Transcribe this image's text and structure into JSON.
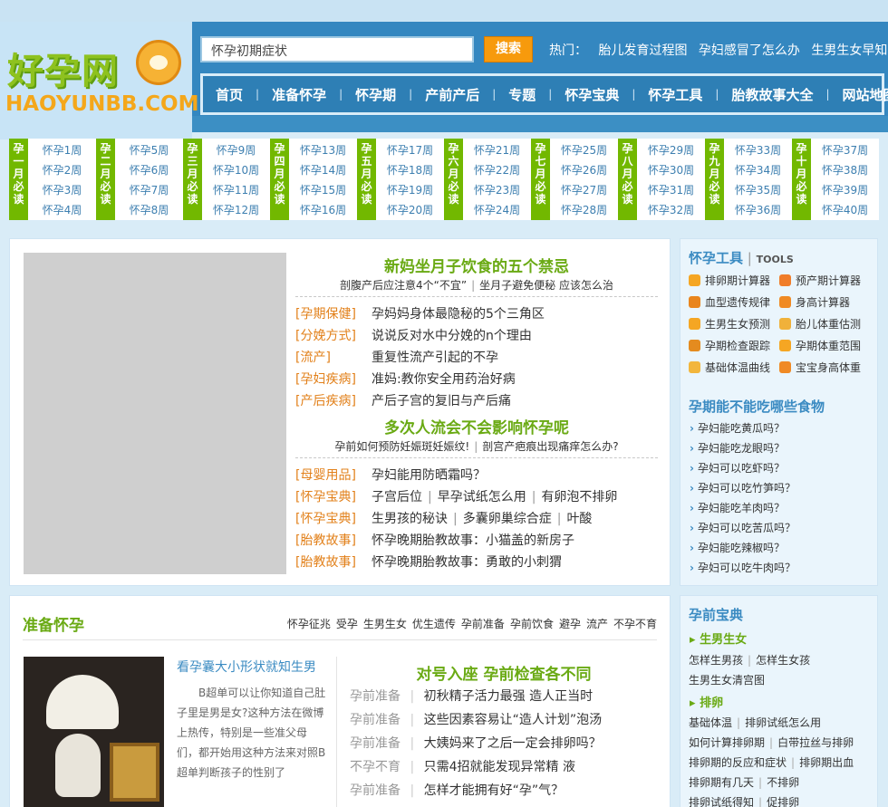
{
  "header": {
    "logo_text": "好孕网",
    "logo_sub": "HAOYUNBB.COM",
    "search_value": "怀孕初期症状",
    "search_button": "搜索",
    "hot_label": "热门：",
    "hot_links": [
      "胎儿发育过程图",
      "孕妇感冒了怎么办",
      "生男生女早知道"
    ]
  },
  "nav": [
    "首页",
    "准备怀孕",
    "怀孕期",
    "产前产后",
    "专题",
    "怀孕宝典",
    "怀孕工具",
    "胎教故事大全",
    "网站地图"
  ],
  "week_grid": [
    {
      "month": "孕一月必读",
      "weeks": [
        "怀孕1周",
        "怀孕2周",
        "怀孕3周",
        "怀孕4周"
      ]
    },
    {
      "month": "孕二月必读",
      "weeks": [
        "怀孕5周",
        "怀孕6周",
        "怀孕7周",
        "怀孕8周"
      ]
    },
    {
      "month": "孕三月必读",
      "weeks": [
        "怀孕9周",
        "怀孕10周",
        "怀孕11周",
        "怀孕12周"
      ]
    },
    {
      "month": "孕四月必读",
      "weeks": [
        "怀孕13周",
        "怀孕14周",
        "怀孕15周",
        "怀孕16周"
      ]
    },
    {
      "month": "孕五月必读",
      "weeks": [
        "怀孕17周",
        "怀孕18周",
        "怀孕19周",
        "怀孕20周"
      ]
    },
    {
      "month": "孕六月必读",
      "weeks": [
        "怀孕21周",
        "怀孕22周",
        "怀孕23周",
        "怀孕24周"
      ]
    },
    {
      "month": "孕七月必读",
      "weeks": [
        "怀孕25周",
        "怀孕26周",
        "怀孕27周",
        "怀孕28周"
      ]
    },
    {
      "month": "孕八月必读",
      "weeks": [
        "怀孕29周",
        "怀孕30周",
        "怀孕31周",
        "怀孕32周"
      ]
    },
    {
      "month": "孕九月必读",
      "weeks": [
        "怀孕33周",
        "怀孕34周",
        "怀孕35周",
        "怀孕36周"
      ]
    },
    {
      "month": "孕十月必读",
      "weeks": [
        "怀孕37周",
        "怀孕38周",
        "怀孕39周",
        "怀孕40周"
      ]
    }
  ],
  "feature": {
    "headline1": "新妈坐月子饮食的五个禁忌",
    "sub1": [
      "剖腹产后应注意4个“不宜”",
      "坐月子避免便秘 应该怎么治"
    ],
    "rows1": [
      {
        "tag": "[孕期保健]",
        "links": [
          "孕妈妈身体最隐秘的5个三角区"
        ]
      },
      {
        "tag": "[分娩方式]",
        "links": [
          "说说反对水中分娩的n个理由"
        ]
      },
      {
        "tag": "[流产]",
        "links": [
          "重复性流产引起的不孕"
        ]
      },
      {
        "tag": "[孕妇疾病]",
        "links": [
          "准妈:教你安全用药治好病"
        ]
      },
      {
        "tag": "[产后疾病]",
        "links": [
          "产后子宫的复旧与产后痛"
        ]
      }
    ],
    "headline2": "多次人流会不会影响怀孕呢",
    "sub2": [
      "孕前如何预防妊娠斑妊娠纹!",
      "剖宫产疤痕出现痛痒怎么办?"
    ],
    "rows2": [
      {
        "tag": "[母婴用品]",
        "links": [
          "孕妇能用防晒霜吗？"
        ]
      },
      {
        "tag": "[怀孕宝典]",
        "links": [
          "子宫后位",
          "早孕试纸怎么用",
          "有卵泡不排卵"
        ]
      },
      {
        "tag": "[怀孕宝典]",
        "links": [
          "生男孩的秘诀",
          "多囊卵巢综合症",
          "叶酸"
        ]
      },
      {
        "tag": "[胎教故事]",
        "links": [
          "怀孕晚期胎教故事：小猫盖的新房子"
        ]
      },
      {
        "tag": "[胎教故事]",
        "links": [
          "怀孕晚期胎教故事：勇敢的小刺猬"
        ]
      }
    ]
  },
  "tools": {
    "title": "怀孕工具",
    "title_en": "TOOLS",
    "items": [
      "排卵期计算器",
      "预产期计算器",
      "血型遗传规律",
      "身高计算器",
      "生男生女预测",
      "胎儿体重估测",
      "孕期检查跟踪",
      "孕期体重范围",
      "基础体温曲线",
      "宝宝身高体重"
    ]
  },
  "foods": {
    "title": "孕期能不能吃哪些食物",
    "items": [
      "孕妇能吃黄瓜吗？",
      "孕妇能吃龙眼吗？",
      "孕妇可以吃虾吗？",
      "孕妇可以吃竹笋吗？",
      "孕妇能吃羊肉吗？",
      "孕妇可以吃苦瓜吗？",
      "孕妇能吃辣椒吗？",
      "孕妇可以吃牛肉吗？"
    ]
  },
  "prepare": {
    "title": "准备怀孕",
    "links": [
      "怀孕征兆",
      "受孕",
      "生男生女",
      "优生遗传",
      "孕前准备",
      "孕前饮食",
      "避孕",
      "流产",
      "不孕不育"
    ],
    "article_title": "看孕囊大小形状就知生男",
    "article_body": "B超单可以让你知道自己肚子里是男是女?这种方法在微博上热传，特别是一些准父母们，都开始用这种方法来对照B超单判断孩子的性别了",
    "headline": "对号入座 孕前检查各不同",
    "rows": [
      {
        "cat": "孕前准备",
        "text": "初秋精子活力最强 造人正当时"
      },
      {
        "cat": "孕前准备",
        "text": "这些因素容易让“造人计划”泡汤"
      },
      {
        "cat": "孕前准备",
        "text": "大姨妈来了之后一定会排卵吗？"
      },
      {
        "cat": "不孕不育",
        "text": "只需4招就能发现异常精 液"
      },
      {
        "cat": "孕前准备",
        "text": "怎样才能拥有好“孕”气？"
      }
    ]
  },
  "baodian": {
    "title": "孕前宝典",
    "h1": "生男生女",
    "l1": [
      "怎样生男孩",
      "怎样生女孩"
    ],
    "l2": [
      "生男生女清宫图"
    ],
    "h2": "排卵",
    "l3": [
      "基础体温",
      "排卵试纸怎么用"
    ],
    "l4": [
      "如何计算排卵期",
      "白带拉丝与排卵"
    ],
    "l5": [
      "排卵期的反应和症状",
      "排卵期出血"
    ],
    "l6": [
      "排卵期有几天",
      "不排卵"
    ],
    "l7": [
      "排卵试纸得知",
      "促排卵"
    ]
  }
}
